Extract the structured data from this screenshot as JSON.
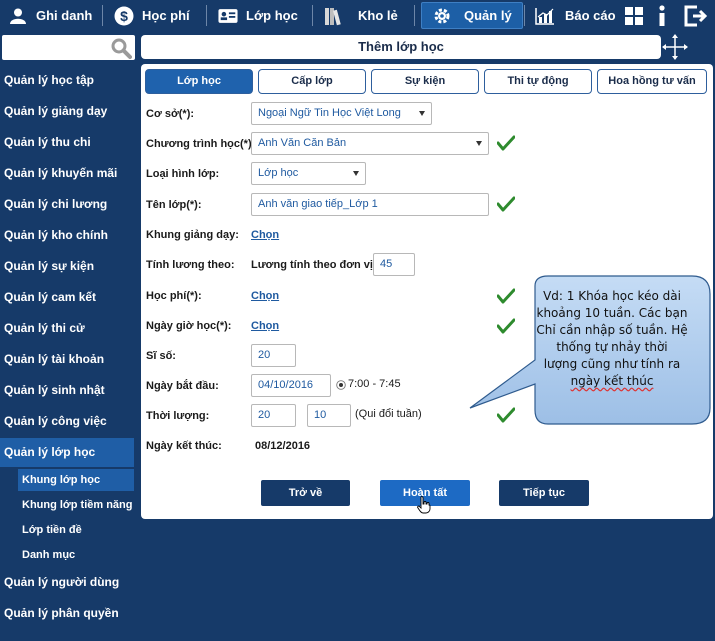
{
  "topnav": {
    "items": [
      {
        "label": "Ghi danh",
        "icon": "user-icon"
      },
      {
        "label": "Học phí",
        "icon": "dollar-icon"
      },
      {
        "label": "Lớp học",
        "icon": "id-card-icon"
      },
      {
        "label": "Kho lẻ",
        "icon": "books-icon"
      },
      {
        "label": "Quản lý",
        "icon": "gear-icon"
      },
      {
        "label": "Báo cáo",
        "icon": "bar-chart-icon"
      }
    ],
    "extra_icons": [
      "grid-icon",
      "info-icon",
      "logout-icon"
    ]
  },
  "sidebar": {
    "items": [
      {
        "label": "Quản lý học tập"
      },
      {
        "label": "Quản lý giảng dạy"
      },
      {
        "label": "Quản lý thu chi"
      },
      {
        "label": "Quản lý khuyến mãi"
      },
      {
        "label": "Quản lý chi lương"
      },
      {
        "label": "Quản lý kho chính"
      },
      {
        "label": "Quản lý sự kiện"
      },
      {
        "label": "Quản lý cam kết"
      },
      {
        "label": "Quản lý thi cử"
      },
      {
        "label": "Quản lý tài khoản"
      },
      {
        "label": "Quản lý sinh nhật"
      },
      {
        "label": "Quản lý công việc"
      },
      {
        "label": "Quản lý lớp học"
      }
    ],
    "subitems": [
      {
        "label": "Khung lớp học"
      },
      {
        "label": "Khung lớp tiềm năng"
      },
      {
        "label": "Lớp tiền đề"
      },
      {
        "label": "Danh mục"
      }
    ],
    "bottom_items": [
      {
        "label": "Quản lý người dùng"
      },
      {
        "label": "Quản lý phân quyền"
      }
    ]
  },
  "page": {
    "title": "Thêm lớp học"
  },
  "tabs": [
    {
      "label": "Lớp học"
    },
    {
      "label": "Cấp lớp"
    },
    {
      "label": "Sự kiện"
    },
    {
      "label": "Thi tự động"
    },
    {
      "label": "Hoa hồng tư vấn"
    }
  ],
  "form": {
    "co_so": {
      "label": "Cơ sở(*):",
      "value": "Ngoại Ngữ Tin Học Việt Long"
    },
    "chuong_trinh": {
      "label": "Chương trình học(*):",
      "value": "Anh Văn Căn Bản"
    },
    "loai_hinh": {
      "label": "Loại hình lớp:",
      "value": "Lớp học"
    },
    "ten_lop": {
      "label": "Tên lớp(*):",
      "value": "Anh văn giao tiếp_Lớp 1"
    },
    "khung_giang_day": {
      "label": "Khung giảng dạy:",
      "link": "Chọn"
    },
    "tinh_luong": {
      "label": "Tính lương theo:",
      "text": "Lương tính theo đơn vị",
      "value": "45"
    },
    "hoc_phi": {
      "label": "Học phí(*):",
      "link": "Chọn"
    },
    "ngay_gio_hoc": {
      "label": "Ngày giờ học(*):",
      "link": "Chọn"
    },
    "si_so": {
      "label": "Sĩ số:",
      "value": "20"
    },
    "ngay_bat_dau": {
      "label": "Ngày bắt đầu:",
      "value": "04/10/2016",
      "time": "7:00 - 7:45"
    },
    "thoi_luong": {
      "label": "Thời lượng:",
      "value1": "20",
      "value2": "10",
      "note": "(Qui đổi tuần)"
    },
    "ngay_ket_thuc": {
      "label": "Ngày kết thúc:",
      "value": "08/12/2016"
    }
  },
  "buttons": {
    "back": "Trở về",
    "done": "Hoàn tất",
    "next": "Tiếp tục"
  },
  "callout": {
    "lines": [
      "Vd: 1 Khóa học kéo dài",
      "khoảng 10 tuần. Các bạn",
      "Chỉ cần nhập số tuần. Hệ",
      "thống tự nhảy thời",
      "lượng cũng như tính ra",
      "ngày kết thúc"
    ]
  },
  "colors": {
    "nav_bg": "#163a69",
    "accent": "#1f62ad",
    "check": "#2e8b2e",
    "callout_bg": "#a9c8ec"
  }
}
